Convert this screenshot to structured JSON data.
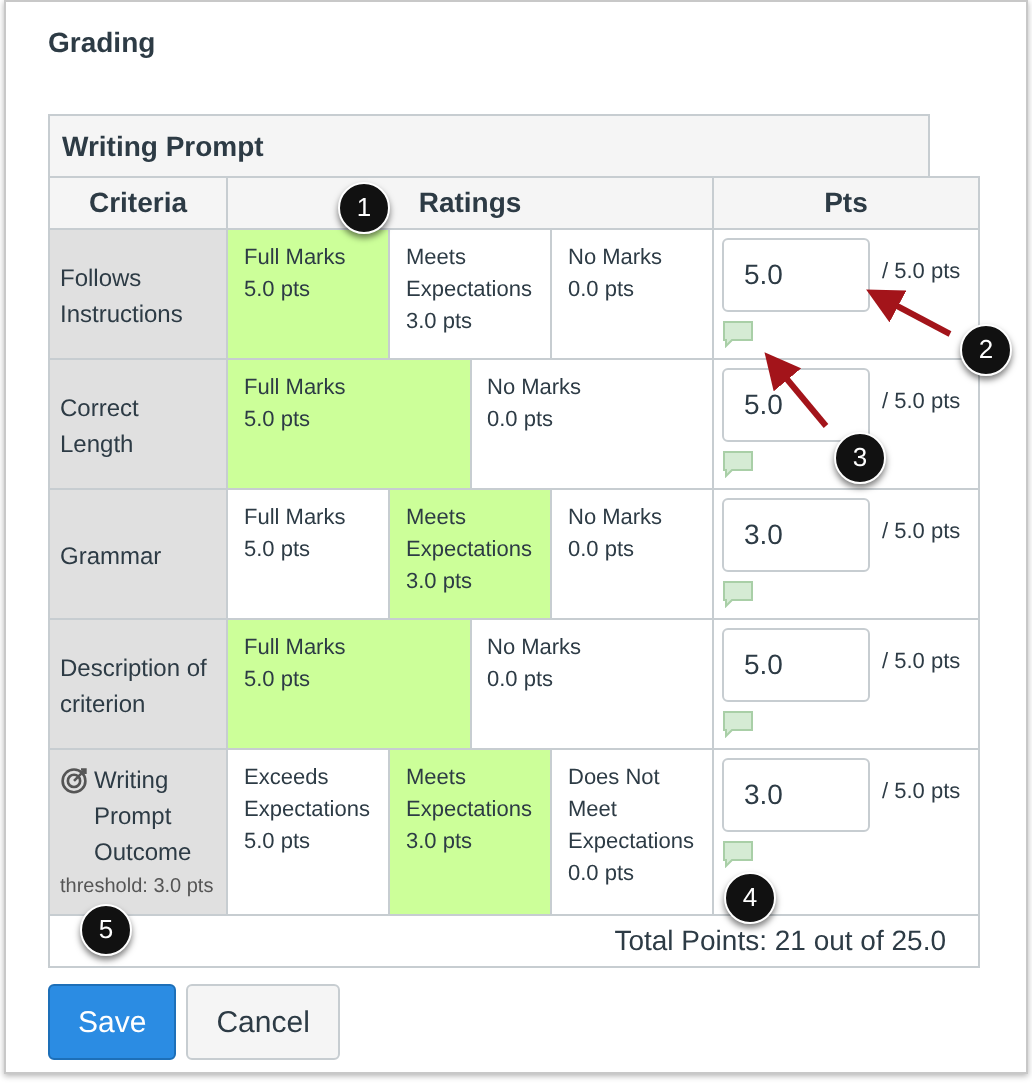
{
  "title": "Grading",
  "rubric": {
    "title": "Writing Prompt",
    "columns": [
      "Criteria",
      "Ratings",
      "Pts"
    ],
    "rows": [
      {
        "criterion": "Follows Instructions",
        "outcome": false,
        "ratings": [
          {
            "name": "Full Marks",
            "points": "5.0 pts",
            "selected": true
          },
          {
            "name": "Meets Expectations",
            "points": "3.0 pts",
            "selected": false
          },
          {
            "name": "No Marks",
            "points": "0.0 pts",
            "selected": false
          }
        ],
        "score": "5.0",
        "max": "/ 5.0 pts"
      },
      {
        "criterion": "Correct Length",
        "outcome": false,
        "ratings": [
          {
            "name": "Full Marks",
            "points": "5.0 pts",
            "selected": true
          },
          {
            "name": "No Marks",
            "points": "0.0 pts",
            "selected": false
          }
        ],
        "score": "5.0",
        "max": "/ 5.0 pts"
      },
      {
        "criterion": "Grammar",
        "outcome": false,
        "ratings": [
          {
            "name": "Full Marks",
            "points": "5.0 pts",
            "selected": false
          },
          {
            "name": "Meets Expectations",
            "points": "3.0 pts",
            "selected": true
          },
          {
            "name": "No Marks",
            "points": "0.0 pts",
            "selected": false
          }
        ],
        "score": "3.0",
        "max": "/ 5.0 pts"
      },
      {
        "criterion": "Description of criterion",
        "outcome": false,
        "ratings": [
          {
            "name": "Full Marks",
            "points": "5.0 pts",
            "selected": true
          },
          {
            "name": "No Marks",
            "points": "0.0 pts",
            "selected": false
          }
        ],
        "score": "5.0",
        "max": "/ 5.0 pts"
      },
      {
        "criterion": "Writing Prompt Outcome",
        "outcome": true,
        "threshold": "threshold: 3.0 pts",
        "ratings": [
          {
            "name": "Exceeds Expectations",
            "points": "5.0 pts",
            "selected": false
          },
          {
            "name": "Meets Expectations",
            "points": "3.0 pts",
            "selected": true
          },
          {
            "name": "Does Not Meet Expectations",
            "points": "0.0 pts",
            "selected": false
          }
        ],
        "score": "3.0",
        "max": "/ 5.0 pts"
      }
    ],
    "total": "Total Points: 21 out of 25.0"
  },
  "buttons": [
    {
      "label": "Save",
      "kind": "primary"
    },
    {
      "label": "Cancel",
      "kind": "default"
    }
  ],
  "callouts": [
    "1",
    "2",
    "3",
    "4",
    "5"
  ]
}
